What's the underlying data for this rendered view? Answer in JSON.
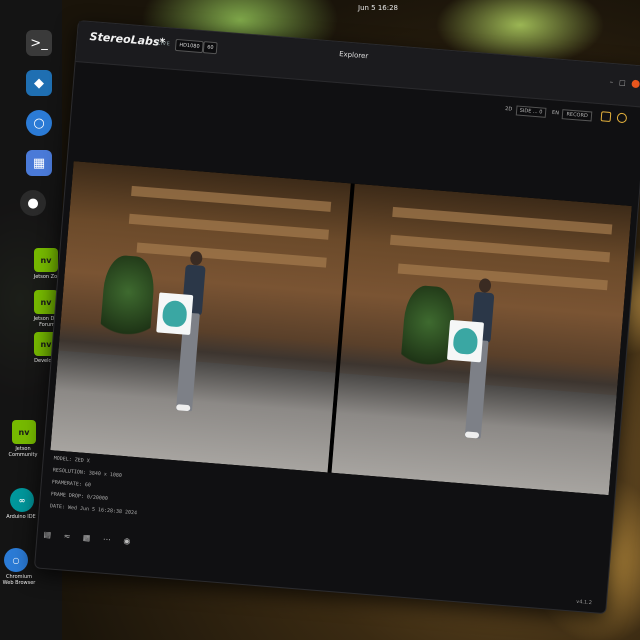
{
  "system": {
    "clock": "Jun 5  16:28"
  },
  "dock": {
    "items": [
      {
        "label": "",
        "icon": "terminal-icon"
      },
      {
        "label": "",
        "icon": "vscode-icon"
      },
      {
        "label": "",
        "icon": "chromium-icon"
      },
      {
        "label": "",
        "icon": "files-icon"
      },
      {
        "label": "",
        "icon": "obs-icon"
      }
    ]
  },
  "desktop": {
    "icons": [
      {
        "label": "Jetson Zoo",
        "icon": "nvidia-icon"
      },
      {
        "label": "Jetson Dev Forum",
        "icon": "nvidia-icon"
      },
      {
        "label": "Developer",
        "icon": "nvidia-icon"
      },
      {
        "label": "Jetson Community",
        "icon": "nvidia-icon"
      },
      {
        "label": "Arduino IDE",
        "icon": "arduino-icon"
      },
      {
        "label": "Chromium Web Browser",
        "icon": "chromium-icon"
      }
    ]
  },
  "app": {
    "brand": "StereoLabs*",
    "mode": "LIVE",
    "resolution_select": "HD1080",
    "fps_select": "60",
    "title": "Explorer",
    "zoom_label": "2D",
    "zoom_select": "SIDE ... 0",
    "record_label": "EN",
    "record_button": "RECORD",
    "info": {
      "model": "MODEL: ZED X",
      "resolution": "RESOLUTION: 3840 x 1080",
      "framerate": "FRAMERATE: 60",
      "frame_drop": "FRAME DROP: 0/20000",
      "date": "DATE: Wed Jun 5 16:28:38 2024"
    },
    "version": "v4.1.2"
  },
  "colors": {
    "accent": "#e8561d",
    "icon_accent": "#e4b13c"
  }
}
